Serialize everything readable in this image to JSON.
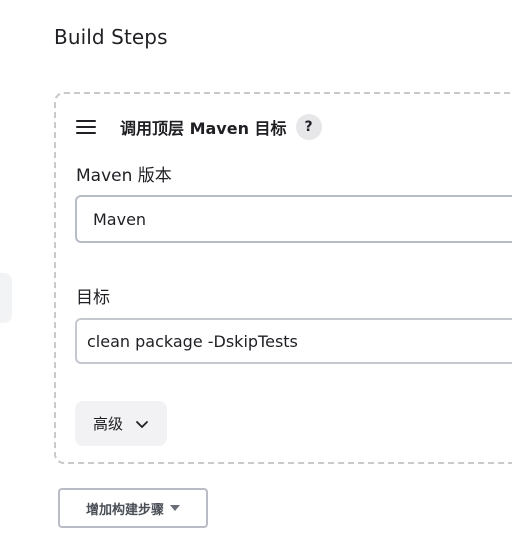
{
  "section": {
    "title": "Build Steps"
  },
  "step": {
    "title": "调用顶层 Maven 目标",
    "help_label": "?",
    "maven_version_label": "Maven 版本",
    "maven_version_value": "Maven",
    "goals_label": "目标",
    "goals_value": "clean package -DskipTests",
    "advanced_label": "高级"
  },
  "actions": {
    "add_step_label": "增加构建步骤"
  },
  "icons": {
    "drag_handle": "drag-handle-icon",
    "help": "help-icon",
    "advanced_chevron": "chevron-down-icon",
    "add_step_caret": "caret-down-icon"
  }
}
